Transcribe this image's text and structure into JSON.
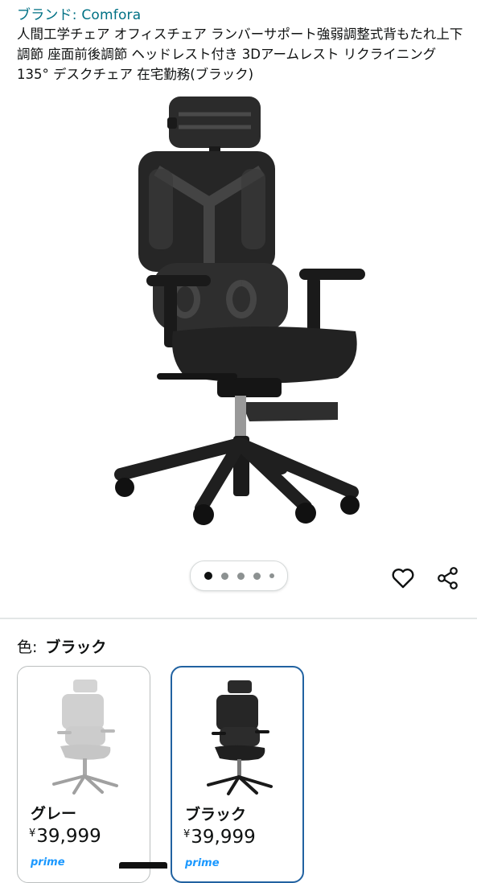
{
  "product": {
    "brand_link": "ブランド: Comfora",
    "title": "人間工学チェア オフィスチェア ランバーサポート強弱調整式背もたれ上下調節 座面前後調節 ヘッドレスト付き 3Dアームレスト リクライニング135° デスクチェア 在宅勤務(ブラック)"
  },
  "gallery": {
    "dots": 5,
    "active_index": 0
  },
  "actions": {
    "wishlist_icon": "heart-icon",
    "share_icon": "share-icon"
  },
  "variation": {
    "label": "色:",
    "selected_value": "ブラック",
    "options": [
      {
        "name": "グレー",
        "currency": "¥",
        "price": "39,999",
        "badge": "prime",
        "swatch_color": "#d8d8d8"
      },
      {
        "name": "ブラック",
        "currency": "¥",
        "price": "39,999",
        "badge": "prime",
        "swatch_color": "#1f1f1f"
      }
    ]
  },
  "colors": {
    "link": "#007185",
    "selected_border": "#2162a1"
  }
}
